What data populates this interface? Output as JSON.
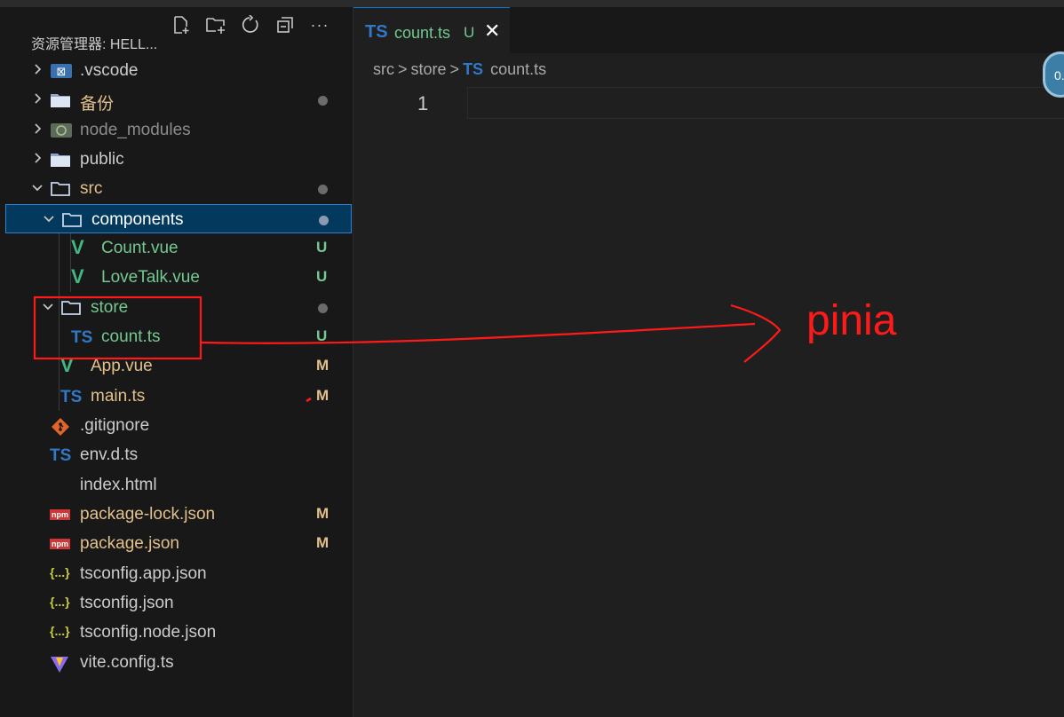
{
  "explorer": {
    "title": "资源管理器: HELL...",
    "header_icons": [
      "new-file-icon",
      "new-folder-icon",
      "refresh-icon",
      "collapse-all-icon",
      "more-icon"
    ],
    "header_more_glyph": "···"
  },
  "tree": [
    {
      "label": ".vscode",
      "kind": "folder-vscode",
      "expanded": false,
      "color": "default",
      "status": ""
    },
    {
      "label": "备份",
      "kind": "folder",
      "expanded": false,
      "color": "yellow",
      "status": "dot"
    },
    {
      "label": "node_modules",
      "kind": "folder-node",
      "expanded": false,
      "color": "dim",
      "status": ""
    },
    {
      "label": "public",
      "kind": "folder",
      "expanded": false,
      "color": "default",
      "status": ""
    },
    {
      "label": "src",
      "kind": "folder-open",
      "expanded": true,
      "color": "yellow",
      "status": "dot"
    },
    {
      "label": "components",
      "kind": "folder-open",
      "expanded": true,
      "color": "default",
      "status": "dot"
    },
    {
      "label": "Count.vue",
      "kind": "vue",
      "color": "green",
      "status": "U"
    },
    {
      "label": "LoveTalk.vue",
      "kind": "vue",
      "color": "green",
      "status": "U"
    },
    {
      "label": "store",
      "kind": "folder-open",
      "expanded": true,
      "color": "green",
      "status": "dot"
    },
    {
      "label": "count.ts",
      "kind": "ts",
      "color": "green",
      "status": "U"
    },
    {
      "label": "App.vue",
      "kind": "vue",
      "color": "yellow",
      "status": "M"
    },
    {
      "label": "main.ts",
      "kind": "ts",
      "color": "yellow",
      "status": "M"
    },
    {
      "label": ".gitignore",
      "kind": "git",
      "color": "default",
      "status": ""
    },
    {
      "label": "env.d.ts",
      "kind": "ts",
      "color": "default",
      "status": ""
    },
    {
      "label": "index.html",
      "kind": "html",
      "color": "default",
      "status": ""
    },
    {
      "label": "package-lock.json",
      "kind": "npm",
      "color": "yellow",
      "status": "M"
    },
    {
      "label": "package.json",
      "kind": "npm",
      "color": "yellow",
      "status": "M"
    },
    {
      "label": "tsconfig.app.json",
      "kind": "json",
      "color": "default",
      "status": ""
    },
    {
      "label": "tsconfig.json",
      "kind": "json",
      "color": "default",
      "status": ""
    },
    {
      "label": "tsconfig.node.json",
      "kind": "json",
      "color": "default",
      "status": ""
    },
    {
      "label": "vite.config.ts",
      "kind": "vite",
      "color": "default",
      "status": ""
    }
  ],
  "icon_glyphs": {
    "ts": "TS",
    "vue": "V",
    "html": "</>",
    "json": "{...}",
    "npm": "npm",
    "vscode_badge": "⊠",
    "node_badge": "JS",
    "chevron_collapsed": "›",
    "chevron_expanded": "⌄"
  },
  "tab": {
    "badge": "TS",
    "file_name": "count.ts",
    "status": "U",
    "close": "✕"
  },
  "breadcrumb": {
    "parts": [
      "src",
      "store",
      "count.ts"
    ],
    "separator": ">",
    "file_badge": "TS"
  },
  "editor": {
    "line_number": "1",
    "avatar_text": "0."
  },
  "annotation": {
    "text": "pinia",
    "color": "#ff1a1a"
  },
  "colors": {
    "sidebar_bg": "#181818",
    "editor_bg": "#1f1f1f",
    "selection_bg": "#04395e",
    "selection_border": "#2f80d0",
    "untracked": "#73c991",
    "modified": "#e2c08d",
    "ts_blue": "#3178c6",
    "vue_green": "#41b883"
  }
}
